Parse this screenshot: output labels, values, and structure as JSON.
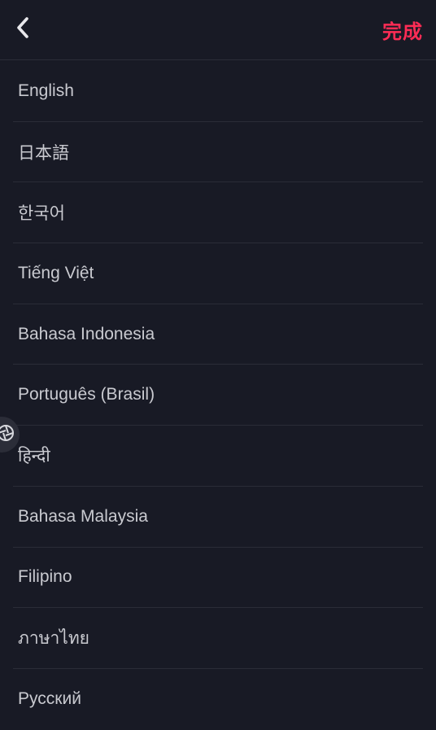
{
  "header": {
    "back_icon": "chevron-left-icon",
    "done_label": "完成",
    "accent_color": "#fe2c55"
  },
  "languages": [
    "English",
    "日本語",
    "한국어",
    "Tiếng Việt",
    "Bahasa Indonesia",
    "Português (Brasil)",
    "हिन्दी",
    "Bahasa Malaysia",
    "Filipino",
    "ภาษาไทย",
    "Русский"
  ],
  "floating_handle": {
    "icon": "aperture-icon"
  }
}
